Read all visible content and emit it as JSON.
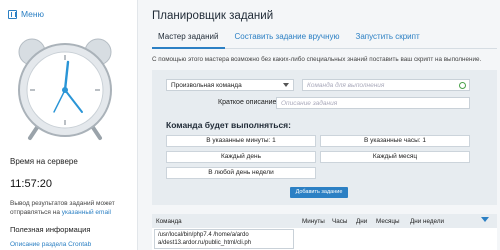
{
  "sidebar": {
    "menu_label": "Меню",
    "server_time_title": "Время на сервере",
    "server_time": "11:57:20",
    "email_note_prefix": "Вывод результатов заданий может отправляться на ",
    "email_note_link": "указанный email",
    "useful_title": "Полезная информация",
    "useful_link": "Описание раздела Crontab"
  },
  "main": {
    "title": "Планировщик заданий",
    "tabs": [
      {
        "label": "Мастер заданий"
      },
      {
        "label": "Составить задание вручную"
      },
      {
        "label": "Запустить скрипт"
      }
    ],
    "hint": "С помощью этого мастера возможно без каких-либо специальных знаний поставить ваш скрипт на выполнение."
  },
  "form": {
    "task_type_selected": "Произвольная команда",
    "command_placeholder": "Команда для выполнения",
    "description_label": "Краткое описание:",
    "description_placeholder": "Описание задания",
    "exec_title": "Команда будет выполняться:",
    "options": {
      "minutes": "В указанные минуты: 1",
      "hours": "В указанные часы: 1",
      "daily": "Каждый день",
      "monthly": "Каждый месяц",
      "weekday": "В любой день недели"
    },
    "add_button": "Добавить задание"
  },
  "table": {
    "headers": {
      "command": "Команда",
      "minutes": "Минуты",
      "hours": "Часы",
      "days": "Дни",
      "months": "Месяцы",
      "weekdays": "Дни недели"
    },
    "rows": [
      {
        "command": "/usr/local/bin/php7.4 /home/a/ardo"
      }
    ],
    "row_command_extra": "a/dest13.ardor.ru/public_html/cli.ph"
  },
  "colors": {
    "accent": "#2c80c4",
    "panel_bg": "#e7ecf0",
    "page_bg": "#f4f6f8"
  }
}
